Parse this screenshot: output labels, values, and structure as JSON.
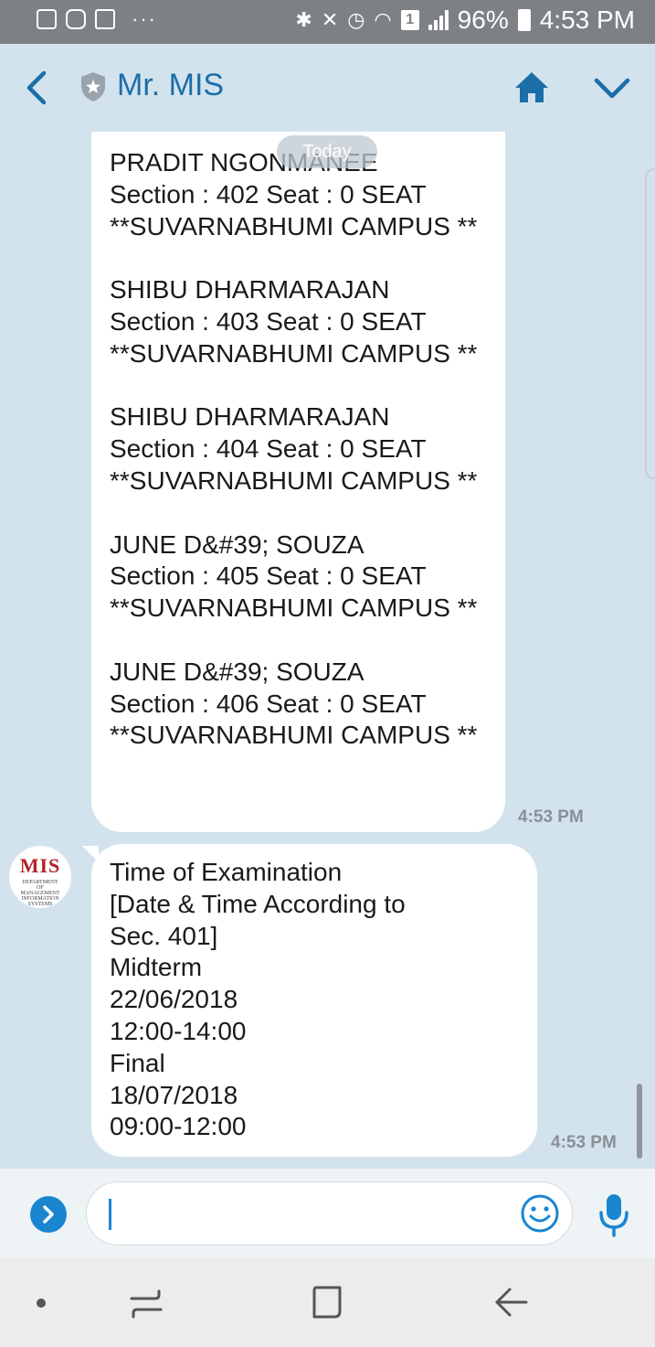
{
  "status_bar": {
    "battery": "96%",
    "time": "4:53 PM",
    "sim_slot": "1",
    "icons": [
      "gallery-icon",
      "instagram-icon",
      "gmail-icon",
      "more-icon",
      "bluetooth-icon",
      "mute-icon",
      "alarm-icon",
      "wifi-icon",
      "sim-icon",
      "signal-icon",
      "battery-icon"
    ]
  },
  "header": {
    "contact_name": "Mr. MIS",
    "icons": [
      "back-arrow-icon",
      "shield-icon",
      "home-icon",
      "chevron-down-icon"
    ]
  },
  "chat": {
    "date_pill": "Today",
    "messages": [
      {
        "text": "PRADIT NGONMANEE\nSection : 402 Seat : 0 SEAT\n**SUVARNABHUMI CAMPUS **\n\nSHIBU DHARMARAJAN\nSection : 403 Seat : 0 SEAT\n**SUVARNABHUMI CAMPUS **\n\nSHIBU DHARMARAJAN\nSection : 404 Seat : 0 SEAT\n**SUVARNABHUMI CAMPUS **\n\nJUNE D&#39; SOUZA\nSection : 405 Seat : 0 SEAT\n**SUVARNABHUMI CAMPUS **\n\nJUNE D&#39; SOUZA\nSection : 406 Seat : 0 SEAT\n**SUVARNABHUMI CAMPUS **",
        "time": "4:53 PM"
      },
      {
        "text": "Time of Examination\n[Date & Time According to\nSec. 401]\nMidterm\n22/06/2018\n12:00-14:00\nFinal\n18/07/2018\n09:00-12:00",
        "time": "4:53 PM"
      }
    ],
    "avatar": {
      "logo_text": "MIS",
      "sub_text": "DEPARTMENT OF MANAGEMENT INFORMATION SYSTEMS"
    }
  },
  "composer": {
    "placeholder": "",
    "icons": [
      "expand-icon",
      "emoji-icon",
      "microphone-icon"
    ]
  },
  "nav_bar": {
    "icons": [
      "dot-icon",
      "recent-apps-icon",
      "home-square-icon",
      "back-icon"
    ]
  },
  "colors": {
    "accent": "#1c6ea8",
    "background": "#d3e3ee",
    "status_bar": "#7d8186",
    "input_accent": "#1a86d0"
  }
}
